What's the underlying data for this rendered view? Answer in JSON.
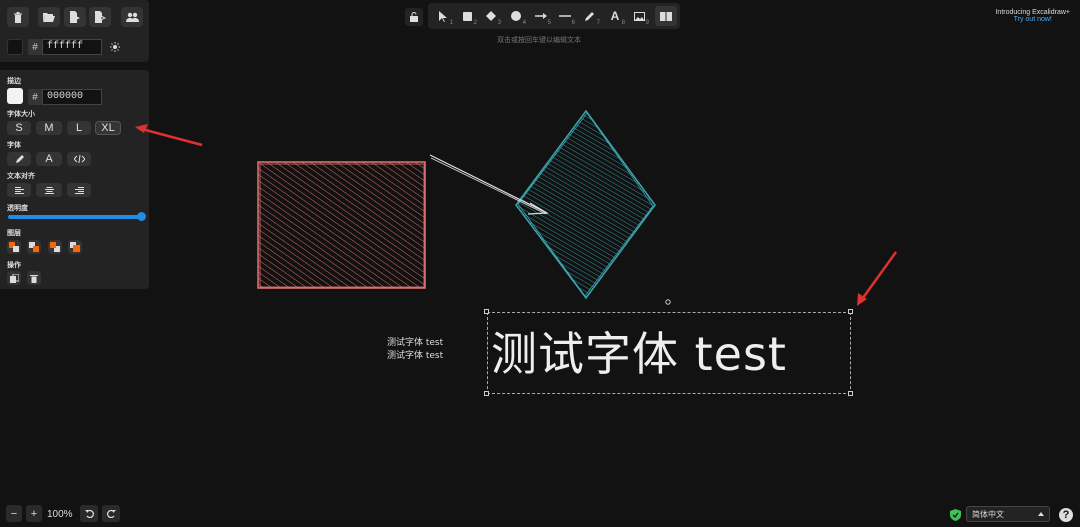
{
  "top_panel": {
    "background_hex": "ffffff",
    "icons": [
      "trash-icon",
      "folder-open-icon",
      "export-icon",
      "export-image-icon",
      "users-icon",
      "sun-icon"
    ]
  },
  "props_panel": {
    "stroke_label": "描边",
    "stroke_hex": "000000",
    "font_size_label": "字体大小",
    "font_sizes": [
      "S",
      "M",
      "L",
      "XL"
    ],
    "font_family_label": "字体",
    "font_family_a": "A",
    "text_align_label": "文本对齐",
    "opacity_label": "透明度",
    "opacity_value": 1.0,
    "layers_label": "图层",
    "actions_label": "操作"
  },
  "toolbar": {
    "numbers": [
      "1",
      "2",
      "3",
      "4",
      "5",
      "6",
      "7",
      "8",
      "9"
    ],
    "text_tool_glyph": "A"
  },
  "hint": "双击或按回车键以编辑文本",
  "promo": {
    "line1": "Introducing Excalidraw+",
    "line2": "Try out now!"
  },
  "canvas": {
    "small_text_1": "测试字体 test",
    "small_text_2": "测试字体 test",
    "big_text": "测试字体 test"
  },
  "bottom": {
    "zoom": "100%",
    "minus": "−",
    "plus": "+",
    "language": "简体中文",
    "help": "?"
  },
  "colors": {
    "accent": "#228be6",
    "rect_stroke": "#e57373",
    "diamond_stroke": "#3ba4b0",
    "annotation_arrow": "#e03131"
  }
}
